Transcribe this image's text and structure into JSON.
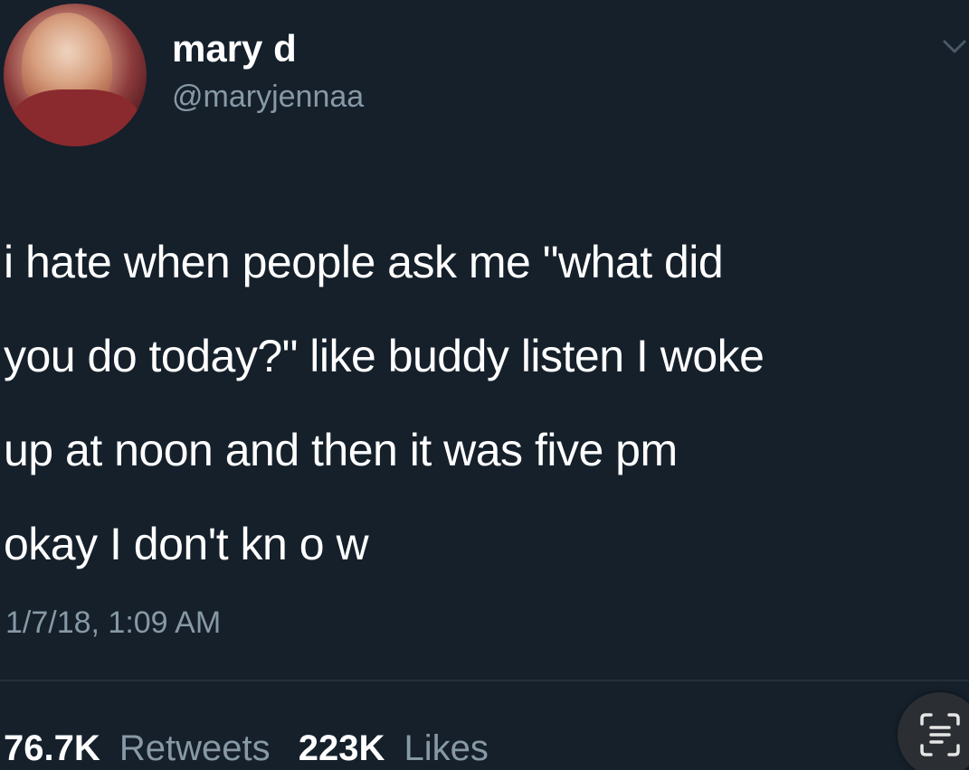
{
  "tweet": {
    "display_name": "mary d",
    "handle": "@maryjennaa",
    "text_lines": [
      "i hate when people ask me \"what did",
      "you do today?\" like buddy listen I woke",
      "up at noon and then it was five pm",
      "okay I don't kn o w"
    ],
    "timestamp": "1/7/18, 1:09 AM",
    "stats": {
      "retweets_count": "76.7K",
      "retweets_label": "Retweets",
      "likes_count": "223K",
      "likes_label": "Likes"
    }
  },
  "icons": {
    "menu": "chevron-down-icon",
    "scan": "text-scan-icon"
  },
  "colors": {
    "background": "#15202b",
    "primary_text": "#ffffff",
    "secondary_text": "#8899a6"
  }
}
